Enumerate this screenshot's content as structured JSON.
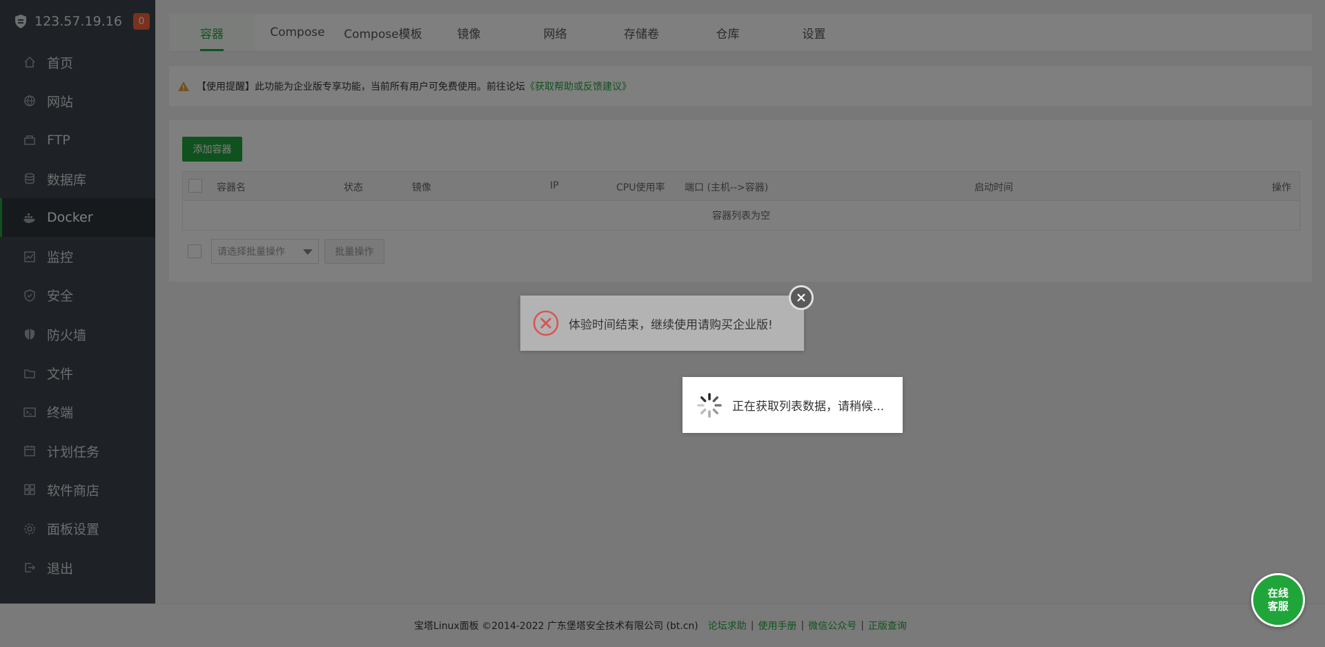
{
  "sidebar": {
    "server_ip": "123.57.19.16",
    "badge_count": "0",
    "items": [
      {
        "label": "首页",
        "icon": "home-icon"
      },
      {
        "label": "网站",
        "icon": "globe-icon"
      },
      {
        "label": "FTP",
        "icon": "ftp-icon"
      },
      {
        "label": "数据库",
        "icon": "database-icon"
      },
      {
        "label": "Docker",
        "icon": "docker-icon",
        "active": true
      },
      {
        "label": "监控",
        "icon": "monitor-icon"
      },
      {
        "label": "安全",
        "icon": "shield-icon"
      },
      {
        "label": "防火墙",
        "icon": "firewall-icon"
      },
      {
        "label": "文件",
        "icon": "folder-icon"
      },
      {
        "label": "终端",
        "icon": "terminal-icon"
      },
      {
        "label": "计划任务",
        "icon": "calendar-icon"
      },
      {
        "label": "软件商店",
        "icon": "grid-icon"
      },
      {
        "label": "面板设置",
        "icon": "gear-icon"
      },
      {
        "label": "退出",
        "icon": "logout-icon"
      }
    ]
  },
  "tabs": [
    {
      "label": "容器",
      "active": true
    },
    {
      "label": "Compose"
    },
    {
      "label": "Compose模板"
    },
    {
      "label": "镜像"
    },
    {
      "label": "网络"
    },
    {
      "label": "存储卷"
    },
    {
      "label": "仓库"
    },
    {
      "label": "设置"
    }
  ],
  "notice": {
    "text": "【使用提醒】此功能为企业版专享功能，当前所有用户可免费使用。前往论坛",
    "link": "《获取帮助或反馈建议》"
  },
  "containers": {
    "add_button": "添加容器",
    "columns": {
      "name": "容器名",
      "status": "状态",
      "image": "镜像",
      "ip": "IP",
      "cpu": "CPU使用率",
      "ports": "端口 (主机-->容器)",
      "started": "启动时间",
      "actions": "操作"
    },
    "empty_text": "容器列表为空",
    "batch_placeholder": "请选择批量操作",
    "batch_button": "批量操作"
  },
  "footer": {
    "copyright": "宝塔Linux面板 ©2014-2022 广东堡塔安全技术有限公司 (bt.cn)",
    "links": [
      "论坛求助",
      "使用手册",
      "微信公众号",
      "正版查询"
    ]
  },
  "dialogs": {
    "error_message": "体验时间结束，继续使用请购买企业版!",
    "loading_message": "正在获取列表数据，请稍候..."
  },
  "chat": {
    "line1": "在线",
    "line2": "客服"
  },
  "colors": {
    "accent": "#20a53a",
    "sidebar_bg": "#3c444d",
    "badge": "#f0643a",
    "error": "#d9534f"
  }
}
